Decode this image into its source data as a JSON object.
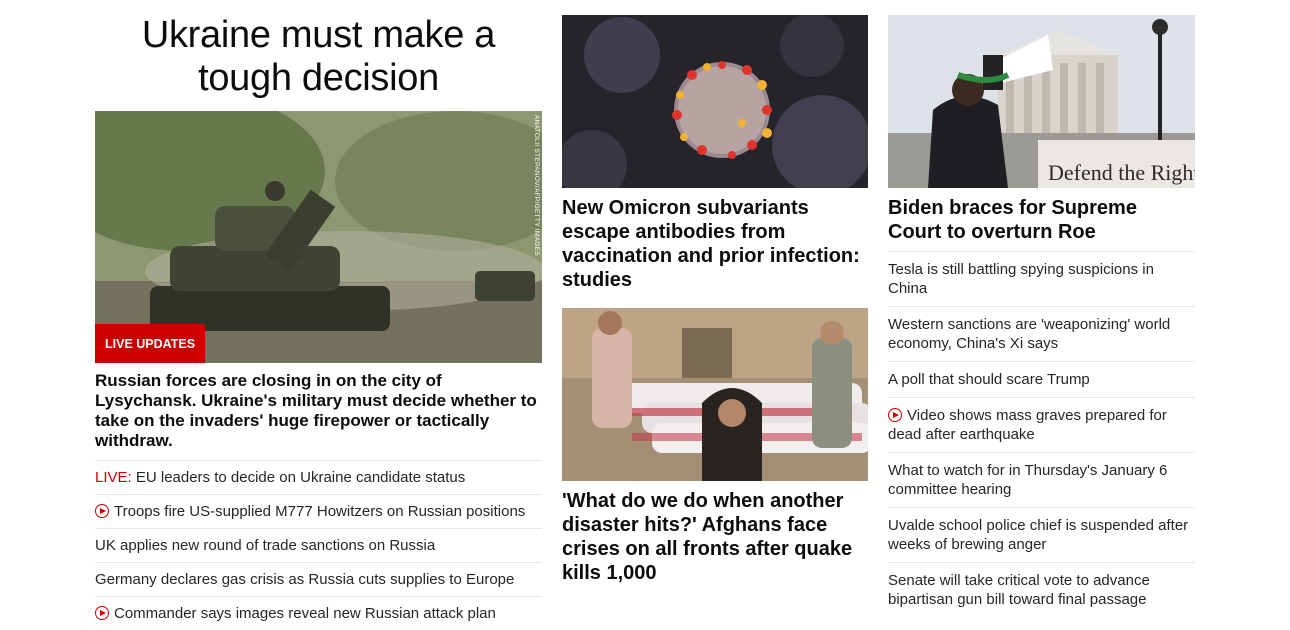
{
  "lead": {
    "headline": "Ukraine must make a tough decision",
    "image_alt": "Ukrainian tanks on a road",
    "photo_credit": "ANATOLII STEPANOV/AFP/GETTY IMAGES",
    "badge": "LIVE UPDATES",
    "summary": "Russian forces are closing in on the city of Lysychansk. Ukraine's military must decide whether to take on the invaders' huge firepower or tactically withdraw.",
    "links": [
      {
        "prefix": "LIVE:",
        "text": " EU leaders to decide on Ukraine candidate status",
        "video": false
      },
      {
        "prefix": "",
        "text": "Troops fire US-supplied M777 Howitzers on Russian positions",
        "video": true
      },
      {
        "prefix": "",
        "text": "UK applies new round of trade sanctions on Russia",
        "video": false
      },
      {
        "prefix": "",
        "text": "Germany declares gas crisis as Russia cuts supplies to Europe",
        "video": false
      },
      {
        "prefix": "",
        "text": "Commander says images reveal new Russian attack plan",
        "video": true
      }
    ]
  },
  "middle": {
    "story1": {
      "title": "New Omicron subvariants escape antibodies from vaccination and prior infection: studies",
      "image_alt": "Coronavirus particle illustration"
    },
    "story2": {
      "title": "'What do we do when another disaster hits?' Afghans face crises on all fronts after quake kills 1,000",
      "image_alt": "Afghan girl standing before covered bodies"
    }
  },
  "right": {
    "story": {
      "title": "Biden braces for Supreme Court to overturn Roe",
      "image_alt": "Protester with megaphone outside Supreme Court",
      "sign_text": "Defend the Right"
    },
    "links": [
      {
        "text": "Tesla is still battling spying suspicions in China",
        "video": false
      },
      {
        "text": "Western sanctions are 'weaponizing' world economy, China's Xi says",
        "video": false
      },
      {
        "text": "A poll that should scare Trump",
        "video": false
      },
      {
        "text": "Video shows mass graves prepared for dead after earthquake",
        "video": true
      },
      {
        "text": "What to watch for in Thursday's January 6 committee hearing",
        "video": false
      },
      {
        "text": "Uvalde school police chief is suspended after weeks of brewing anger",
        "video": false
      },
      {
        "text": "Senate will take critical vote to advance bipartisan gun bill toward final passage",
        "video": false
      }
    ]
  },
  "colors": {
    "accent_red": "#cc0000",
    "text": "#0c0c0c",
    "divider": "#e6e6e6"
  }
}
